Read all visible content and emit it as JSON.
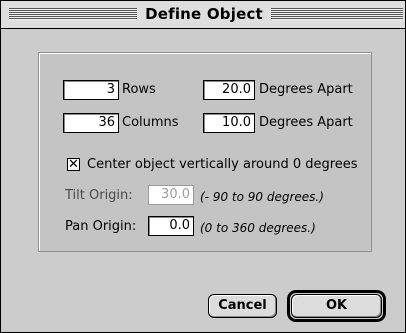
{
  "dialog": {
    "title": "Define Object"
  },
  "grid": {
    "rows_value": "3",
    "rows_label": "Rows",
    "rows_degrees_value": "20.0",
    "rows_degrees_label": "Degrees Apart",
    "columns_value": "36",
    "columns_label": "Columns",
    "columns_degrees_value": "10.0",
    "columns_degrees_label": "Degrees Apart"
  },
  "center_option": {
    "checked": true,
    "mark": "✕",
    "label": "Center object vertically around 0 degrees"
  },
  "tilt": {
    "label": "Tilt Origin:",
    "value": "30.0",
    "range_hint": "(- 90 to 90 degrees.)",
    "disabled": true
  },
  "pan": {
    "label": "Pan Origin:",
    "value": "0.0",
    "range_hint": "(0 to 360 degrees.)"
  },
  "buttons": {
    "cancel_label": "Cancel",
    "ok_label": "OK"
  }
}
